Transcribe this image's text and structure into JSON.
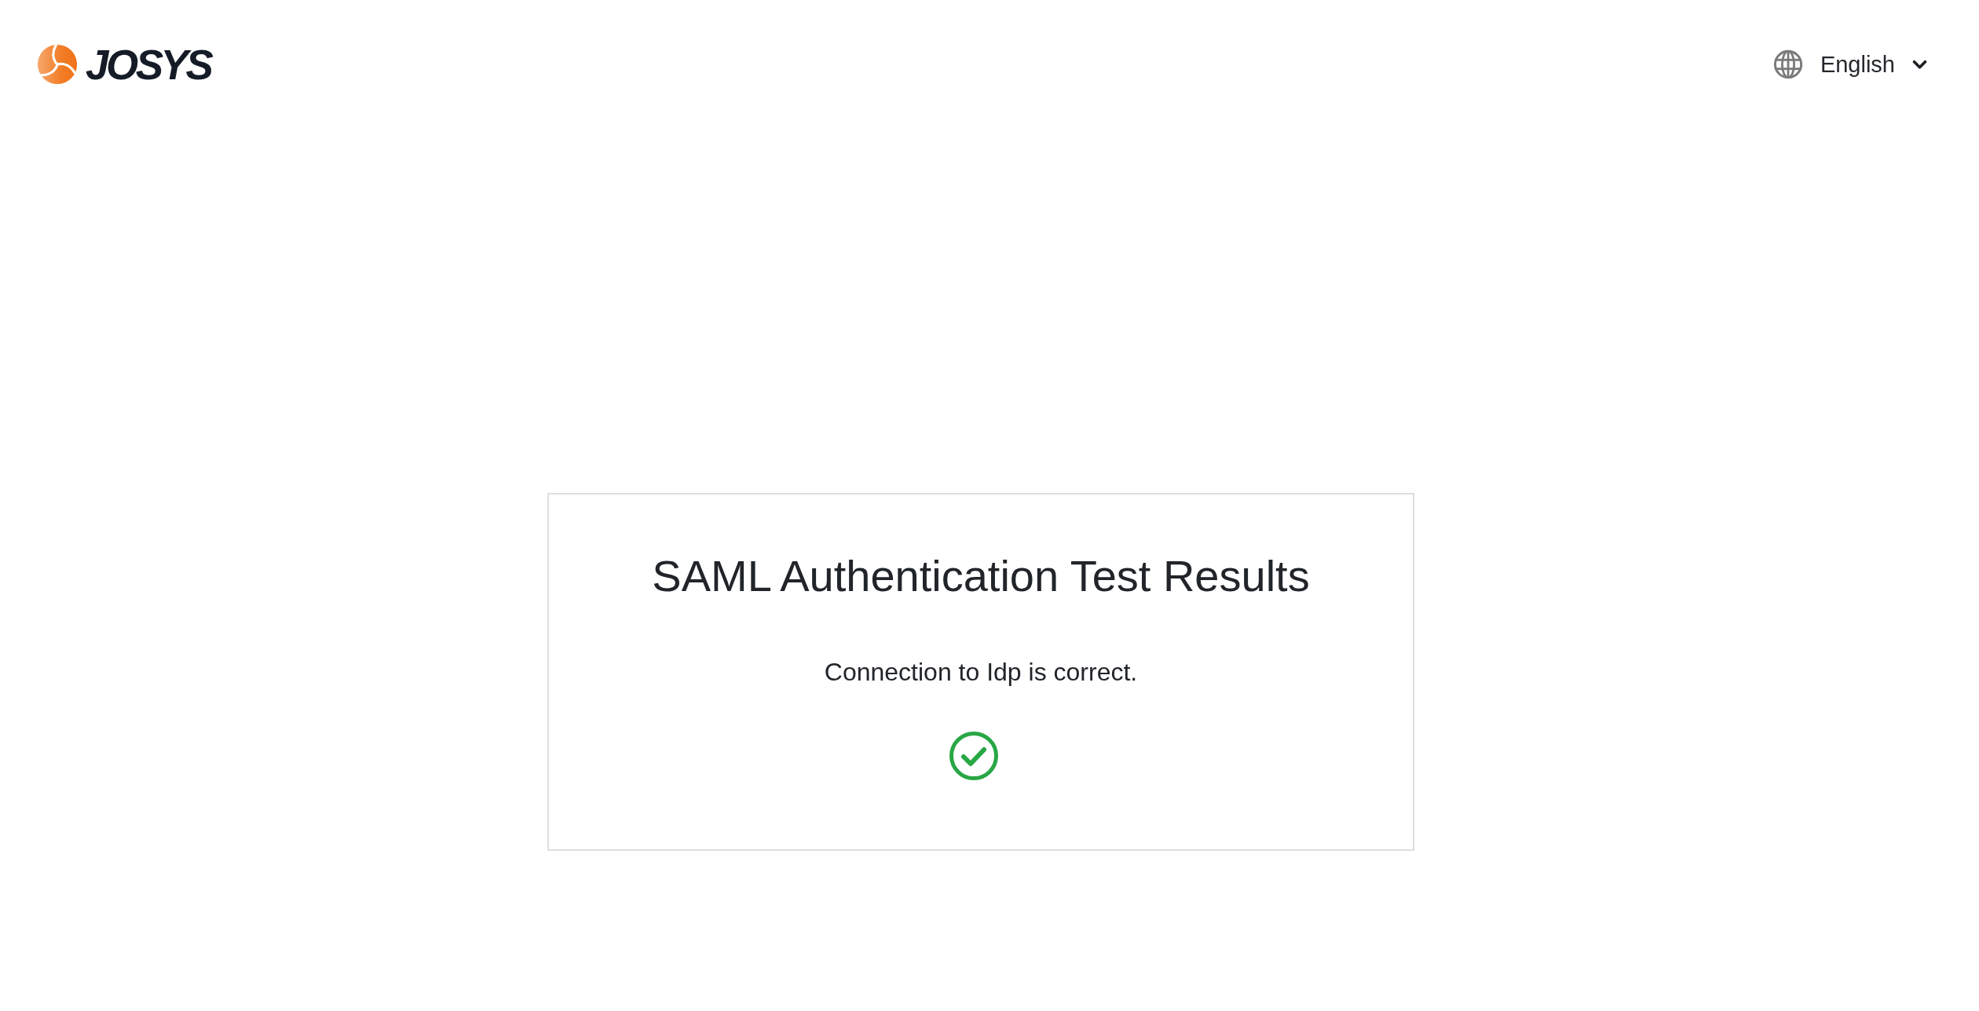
{
  "header": {
    "logo": {
      "wordmark": "JOSYS"
    },
    "language_selector": {
      "label": "English"
    }
  },
  "card": {
    "title": "SAML Authentication Test Results",
    "message": "Connection to Idp is correct.",
    "result": {
      "kind": "success"
    }
  }
}
